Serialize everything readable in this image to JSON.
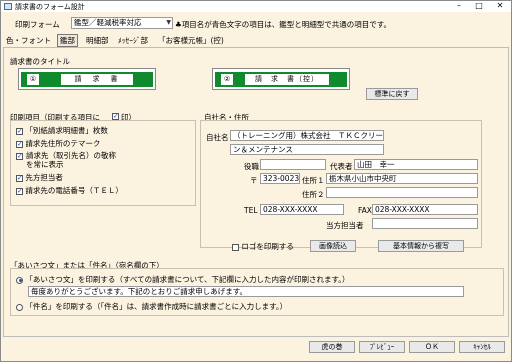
{
  "window": {
    "title": "請求書のフォーム設計",
    "minimize": "–",
    "maximize": "□",
    "close": "✕"
  },
  "top": {
    "form_label": "印刷フォーム",
    "form_type": "鑑型",
    "form_variant": "／軽減税率対応",
    "note": "♣項目名が青色文字の項目は、鑑型と明細型で共通の項目です。"
  },
  "tabs": [
    "色・フォント",
    "鑑部",
    "明細部",
    "ﾒｯｾｰｼﾞ部",
    "「お客様元帳」(控)"
  ],
  "title_section": {
    "heading": "請求書のタイトル",
    "title1_num": "①",
    "title1": "請　求　書",
    "title2_num": "②",
    "title2": "請　求　書（控）",
    "reset_button": "標準に戻す"
  },
  "print_items": {
    "heading": "印刷項目（印刷する項目に",
    "heading_mark": "印）",
    "items": [
      {
        "label": "「別紙請求明細書」枚数",
        "checked": true
      },
      {
        "label": "請求先住所のテマーク",
        "checked": true
      },
      {
        "label": "請求先（取引先名）の敬称を常に表示",
        "checked": true
      },
      {
        "label": "先方担当者",
        "checked": true
      },
      {
        "label": "請求先の電話番号（ＴＥＬ）",
        "checked": true
      }
    ]
  },
  "company": {
    "heading": "自社名・住所",
    "name_label": "自社名",
    "name_line1": "（トレーニング用）株式会社　ＴＫＣクリー",
    "name_line2": "ン＆メンテナンス",
    "role_label": "役職",
    "role_value": "",
    "rep_label": "代表者",
    "rep_value": "山田　幸一",
    "zip_label": "〒",
    "zip_value": "323-0023",
    "addr1_label": "住所１",
    "addr1_value": "栃木県小山市中央町",
    "addr2_label": "住所２",
    "addr2_value": "",
    "tel_label": "TEL",
    "tel_value": "028-XXX-XXXX",
    "fax_label": "FAX",
    "fax_value": "028-XXX-XXXX",
    "contact_label": "当方担当者",
    "contact_value": "",
    "logo_label": "ロゴを印刷する",
    "logo_checked": false,
    "image_button": "画像読込",
    "copy_button": "基本情報から複写"
  },
  "greeting": {
    "heading": "「あいさつ文」または「件名」（宛名欄の下）",
    "option1": "「あいさつ文」を印刷する（すべての請求書について、下記欄に入力した内容が印刷されます。）",
    "option1_text": "毎度ありがとうございます。下記のとおりご請求申しあげます。",
    "option2": "「件名」を印刷する（「件名」は、請求書作成時に請求書ごとに入力します。）",
    "selected": 1
  },
  "footer": {
    "tora": "虎の巻",
    "preview": "ﾌﾟﾚﾋﾞｭｰ",
    "ok": "ＯＫ",
    "cancel": "ｷｬﾝｾﾙ"
  }
}
